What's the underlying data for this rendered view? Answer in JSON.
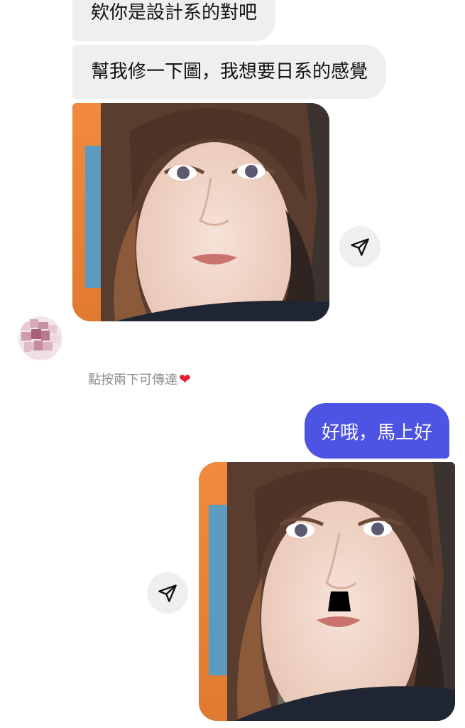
{
  "thread": {
    "incoming": [
      {
        "text": "欸你是設計系的對吧"
      },
      {
        "text": "幫我修一下圖，我想要日系的感覺"
      }
    ],
    "incoming_photo": {
      "subject": "selfie-photo"
    },
    "double_tap_hint": "點按兩下可傳達",
    "hint_heart": "❤",
    "outgoing": [
      {
        "text": "好哦，馬上好"
      }
    ],
    "outgoing_photo": {
      "subject": "edited-selfie-photo-with-mustache"
    }
  },
  "icons": {
    "share": "paper-plane-icon",
    "avatar": "pixelated-avatar"
  },
  "colors": {
    "incoming_bubble": "#efefef",
    "outgoing_bubble": "#4d53e3",
    "hint_text": "#8e8e8e",
    "heart": "#e0202f"
  }
}
